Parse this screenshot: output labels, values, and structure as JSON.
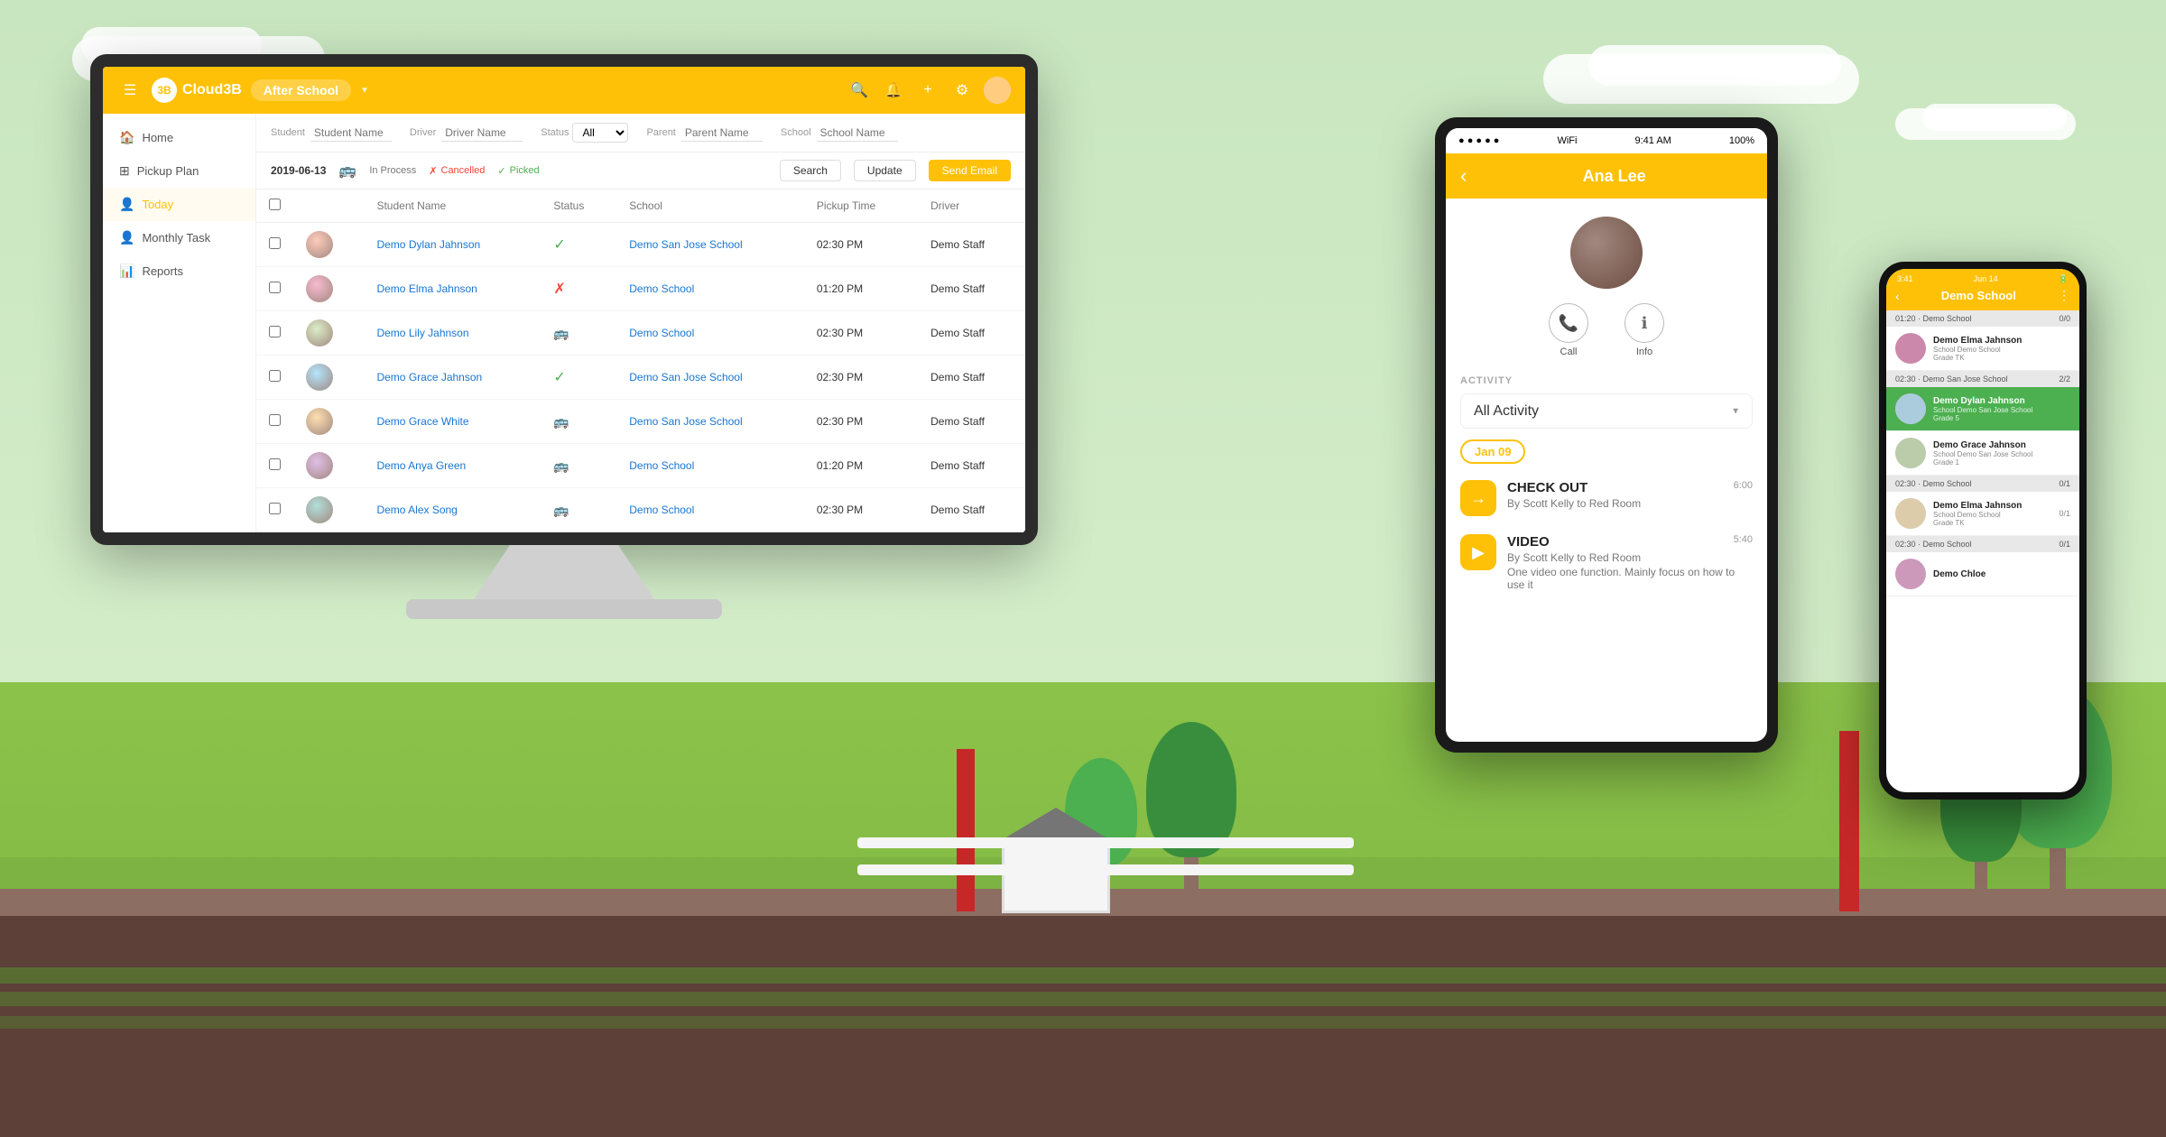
{
  "scene": {
    "bg_color": "#c8e6c0"
  },
  "app": {
    "logo": "3B",
    "brand": "Cloud3B",
    "header_title": "After School",
    "nav": {
      "icons": {
        "menu": "☰",
        "search": "🔍",
        "bell": "🔔",
        "plus": "+",
        "gear": "⚙",
        "avatar": "👤"
      }
    },
    "sidebar": {
      "items": [
        {
          "label": "Home",
          "icon": "🏠",
          "active": false
        },
        {
          "label": "Pickup Plan",
          "icon": "⊞",
          "active": false
        },
        {
          "label": "Today",
          "icon": "👤",
          "active": true
        },
        {
          "label": "Monthly Task",
          "icon": "👤",
          "active": false
        },
        {
          "label": "Reports",
          "icon": "📊",
          "active": false
        }
      ]
    },
    "filters": {
      "student_label": "Student",
      "student_placeholder": "Student Name",
      "driver_label": "Driver",
      "driver_placeholder": "Driver Name",
      "status_label": "Status",
      "status_value": "All",
      "parent_label": "Parent",
      "parent_placeholder": "Parent Name",
      "school_label": "School",
      "school_placeholder": "School Name"
    },
    "action_bar": {
      "date": "2019-06-13",
      "status_in_process": "In Process",
      "status_cancelled": "Cancelled",
      "status_picked": "Picked",
      "btn_search": "Search",
      "btn_update": "Update",
      "btn_send_email": "Send Email"
    },
    "table": {
      "columns": [
        "Student Name",
        "Status",
        "School",
        "Pickup Time",
        "Driver"
      ],
      "rows": [
        {
          "name": "Demo Dylan Jahnson",
          "status": "picked",
          "school": "Demo San Jose School",
          "time": "02:30 PM",
          "driver": "Demo Staff"
        },
        {
          "name": "Demo Elma Jahnson",
          "status": "cancelled",
          "school": "Demo School",
          "time": "01:20 PM",
          "driver": "Demo Staff"
        },
        {
          "name": "Demo Lily Jahnson",
          "status": "bus",
          "school": "Demo School",
          "time": "02:30 PM",
          "driver": "Demo Staff"
        },
        {
          "name": "Demo Grace Jahnson",
          "status": "picked",
          "school": "Demo San Jose School",
          "time": "02:30 PM",
          "driver": "Demo Staff"
        },
        {
          "name": "Demo Grace White",
          "status": "bus",
          "school": "Demo San Jose School",
          "time": "02:30 PM",
          "driver": "Demo Staff"
        },
        {
          "name": "Demo Anya Green",
          "status": "bus",
          "school": "Demo School",
          "time": "01:20 PM",
          "driver": "Demo Staff"
        },
        {
          "name": "Demo Alex Song",
          "status": "bus",
          "school": "Demo School",
          "time": "02:30 PM",
          "driver": "Demo Staff"
        }
      ]
    }
  },
  "tablet": {
    "time": "9:41 AM",
    "battery": "100%",
    "person_name": "Ana Lee",
    "back_arrow": "‹",
    "action_call": "Call",
    "action_info": "Info",
    "activity_label": "ACTIVITY",
    "activity_dropdown": "All Activity",
    "date_tag": "Jan 09",
    "items": [
      {
        "type": "CHECK OUT",
        "time": "6:00",
        "by": "By Scott Kelly to Red Room",
        "icon": "→",
        "icon_bg": "#FFC107"
      },
      {
        "type": "VIDEO",
        "time": "5:40",
        "by": "By Scott Kelly to Red Room",
        "desc": "One video one function. Mainly focus on how to use it",
        "icon": "▶",
        "icon_bg": "#FFC107"
      }
    ]
  },
  "phone": {
    "time": "3:41",
    "date": "Jun 14",
    "header_title": "Demo School",
    "sections": [
      {
        "label": "01:20 - Demo School",
        "count": "0/0",
        "items": [
          {
            "name": "Demo Elma Jahnson",
            "school": "Demo School",
            "grade": "TK",
            "active": false,
            "count": ""
          }
        ]
      },
      {
        "label": "02:30 - Demo San Jose School",
        "count": "2/2",
        "items": [
          {
            "name": "Demo Dylan Jahnson",
            "school": "Demo San Jose School",
            "grade": "5",
            "active": true,
            "count": ""
          },
          {
            "name": "Demo Grace Jahnson",
            "school": "Demo San Jose School",
            "grade": "1",
            "active": false,
            "count": ""
          }
        ]
      },
      {
        "label": "02:30 - Demo School",
        "count": "0/1",
        "items": [
          {
            "name": "Demo Elma Jahnson",
            "school": "Demo School",
            "grade": "TK",
            "active": false,
            "count": "0/1"
          }
        ]
      },
      {
        "label": "02:30 - Demo School",
        "count": "0/1",
        "items": [
          {
            "name": "Demo Chloe",
            "school": "",
            "grade": "",
            "active": false,
            "count": ""
          }
        ]
      }
    ]
  }
}
